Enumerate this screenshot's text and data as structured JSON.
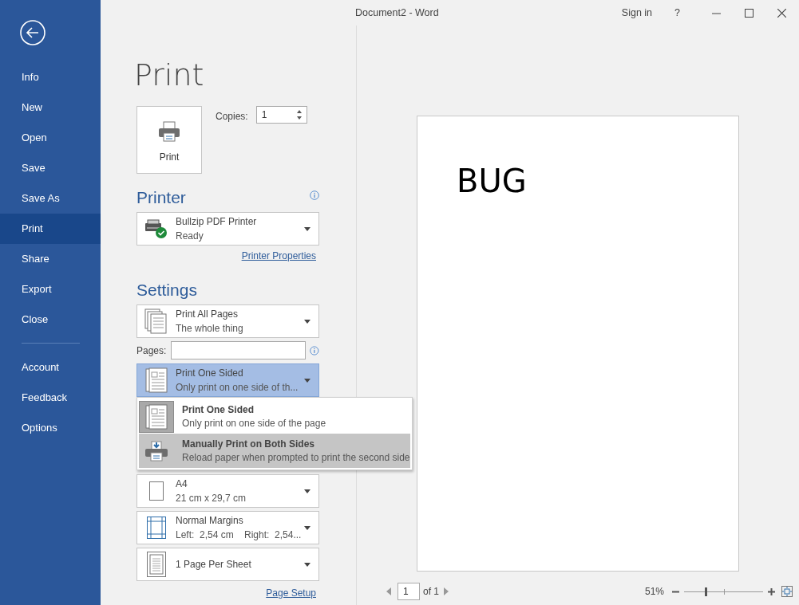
{
  "window": {
    "title": "Document2  -  Word",
    "sign_in": "Sign in",
    "help": "?"
  },
  "sidebar": {
    "items": [
      {
        "label": "Info",
        "selected": false,
        "separator_before": false
      },
      {
        "label": "New",
        "selected": false,
        "separator_before": false
      },
      {
        "label": "Open",
        "selected": false,
        "separator_before": false
      },
      {
        "label": "Save",
        "selected": false,
        "separator_before": false
      },
      {
        "label": "Save As",
        "selected": false,
        "separator_before": false
      },
      {
        "label": "Print",
        "selected": true,
        "separator_before": false
      },
      {
        "label": "Share",
        "selected": false,
        "separator_before": false
      },
      {
        "label": "Export",
        "selected": false,
        "separator_before": false
      },
      {
        "label": "Close",
        "selected": false,
        "separator_before": false
      },
      {
        "label": "Account",
        "selected": false,
        "separator_before": true
      },
      {
        "label": "Feedback",
        "selected": false,
        "separator_before": false
      },
      {
        "label": "Options",
        "selected": false,
        "separator_before": false
      }
    ]
  },
  "print": {
    "heading": "Print",
    "button": "Print",
    "copies_label": "Copies:",
    "copies": "1"
  },
  "printer": {
    "heading": "Printer",
    "name": "Bullzip PDF Printer",
    "status": "Ready",
    "properties_link": "Printer Properties"
  },
  "settings": {
    "heading": "Settings",
    "pages_label": "Pages:",
    "page_setup_link": "Page Setup",
    "dropdowns": [
      {
        "kind": "pages",
        "title": "Print All Pages",
        "subtitle": "The whole thing",
        "open": false
      },
      {
        "kind": "sides",
        "title": "Print One Sided",
        "subtitle": "Only print on one side of th...",
        "open": true
      },
      {
        "kind": "paper",
        "title": "A4",
        "subtitle": "21 cm x 29,7 cm",
        "open": false
      },
      {
        "kind": "margins",
        "title": "Normal Margins",
        "subtitle": "Left:  2,54 cm    Right:  2,54...",
        "open": false
      },
      {
        "kind": "sheet",
        "title": "1 Page Per Sheet",
        "open": false
      }
    ],
    "menu": {
      "items": [
        {
          "kind": "one-sided",
          "title": "Print One Sided",
          "subtitle": "Only print on one side of the page",
          "selected": true,
          "highlighted": false
        },
        {
          "kind": "manual-duplex",
          "title": "Manually Print on Both Sides",
          "subtitle": "Reload paper when prompted to print the second side",
          "selected": false,
          "highlighted": true
        }
      ]
    }
  },
  "preview": {
    "text": "BUG",
    "page": "1",
    "of": "of 1",
    "zoom": "51%",
    "zoom_slider": {
      "level": 0.27
    }
  }
}
